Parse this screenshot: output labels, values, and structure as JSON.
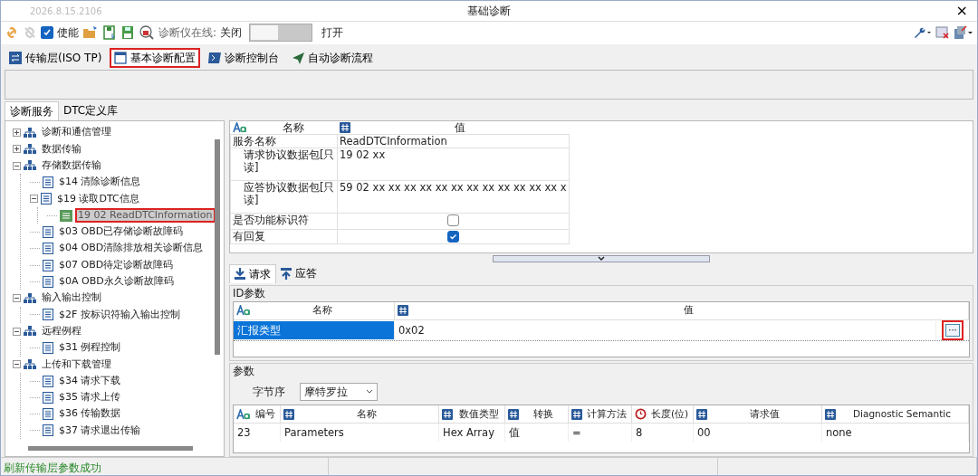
{
  "window": {
    "version": "2026.8.15.2106",
    "title": "基础诊断",
    "close": "×"
  },
  "toolbar": {
    "enable": {
      "label": "使能",
      "checked": true
    },
    "online_label": "诊断仪在线:",
    "switch_off": "关闭",
    "switch_on": "打开",
    "switch": {
      "on": false
    }
  },
  "tabs": [
    {
      "label": "传输层(ISO TP)",
      "kind": "transport",
      "selected": false,
      "highlighted": false
    },
    {
      "label": "基本诊断配置",
      "kind": "config",
      "selected": true,
      "highlighted": true
    },
    {
      "label": "诊断控制台",
      "kind": "console",
      "selected": false,
      "highlighted": false
    },
    {
      "label": "自动诊断流程",
      "kind": "flow",
      "selected": false,
      "highlighted": false
    }
  ],
  "side_tabs": [
    {
      "label": "诊断服务",
      "selected": true
    },
    {
      "label": "DTC定义库",
      "selected": false
    }
  ],
  "tree": [
    {
      "label": "诊断和通信管理",
      "kind": "group",
      "expanded": false
    },
    {
      "label": "数据传输",
      "kind": "group",
      "expanded": false
    },
    {
      "label": "存储数据传输",
      "kind": "group",
      "expanded": true,
      "children": [
        {
          "label": "$14 清除诊断信息",
          "kind": "service"
        },
        {
          "label": "$19 读取DTC信息",
          "kind": "service",
          "expanded": true,
          "children": [
            {
              "label": "19 02 ReadDTCInformation",
              "kind": "sub",
              "selected": true,
              "highlighted": true
            }
          ]
        },
        {
          "label": "$03 OBD已存储诊断故障码",
          "kind": "service"
        },
        {
          "label": "$04 OBD清除排放相关诊断信息",
          "kind": "service"
        },
        {
          "label": "$07 OBD待定诊断故障码",
          "kind": "service"
        },
        {
          "label": "$0A OBD永久诊断故障码",
          "kind": "service"
        }
      ]
    },
    {
      "label": "输入输出控制",
      "kind": "group",
      "expanded": true,
      "children": [
        {
          "label": "$2F 按标识符输入输出控制",
          "kind": "service"
        }
      ]
    },
    {
      "label": "远程例程",
      "kind": "group",
      "expanded": true,
      "children": [
        {
          "label": "$31 例程控制",
          "kind": "service"
        }
      ]
    },
    {
      "label": "上传和下载管理",
      "kind": "group",
      "expanded": true,
      "children": [
        {
          "label": "$34 请求下载",
          "kind": "service"
        },
        {
          "label": "$35 请求上传",
          "kind": "service"
        },
        {
          "label": "$36 传输数据",
          "kind": "service"
        },
        {
          "label": "$37 请求退出传输",
          "kind": "service"
        }
      ]
    }
  ],
  "properties": {
    "columns": [
      "名称",
      "值"
    ],
    "rows": [
      {
        "name": "服务名称",
        "kind": "text",
        "value": "ReadDTCInformation"
      },
      {
        "name": "请求协议数据包[只读]",
        "kind": "text",
        "value": "19 02 xx"
      },
      {
        "name": "应答协议数据包[只读]",
        "kind": "text",
        "value": "59 02 xx xx xx xx xx xx xx xx xx xx xx xx x"
      },
      {
        "name": "是否功能标识符",
        "kind": "check",
        "checked": false
      },
      {
        "name": "有回复",
        "kind": "check",
        "checked": true
      }
    ]
  },
  "sub_tabs": [
    {
      "label": "请求",
      "kind": "down",
      "selected": true
    },
    {
      "label": "应答",
      "kind": "up",
      "selected": false
    }
  ],
  "id_params": {
    "title": "ID参数",
    "columns": [
      "名称",
      "值"
    ],
    "rows": [
      {
        "name": "汇报类型",
        "value": "0x02",
        "selected": true
      }
    ],
    "more_button": {
      "label": "···",
      "highlighted": true
    }
  },
  "params": {
    "title": "参数",
    "byte_order_label": "字节序",
    "byte_order": "摩特罗拉",
    "columns": [
      {
        "label": "编号",
        "kind": "text"
      },
      {
        "label": "名称",
        "kind": "number"
      },
      {
        "label": "数值类型",
        "kind": "number"
      },
      {
        "label": "转换",
        "kind": "number"
      },
      {
        "label": "计算方法",
        "kind": "number"
      },
      {
        "label": "长度(位)",
        "kind": "clock"
      },
      {
        "label": "请求值",
        "kind": "number"
      },
      {
        "label": "Diagnostic Semantic",
        "kind": "number"
      }
    ],
    "rows": [
      [
        "23",
        "Parameters",
        "Hex Array",
        "值",
        "=",
        "8",
        "00",
        "none"
      ]
    ]
  },
  "status_bar": {
    "message": "刷新传输层参数成功"
  }
}
